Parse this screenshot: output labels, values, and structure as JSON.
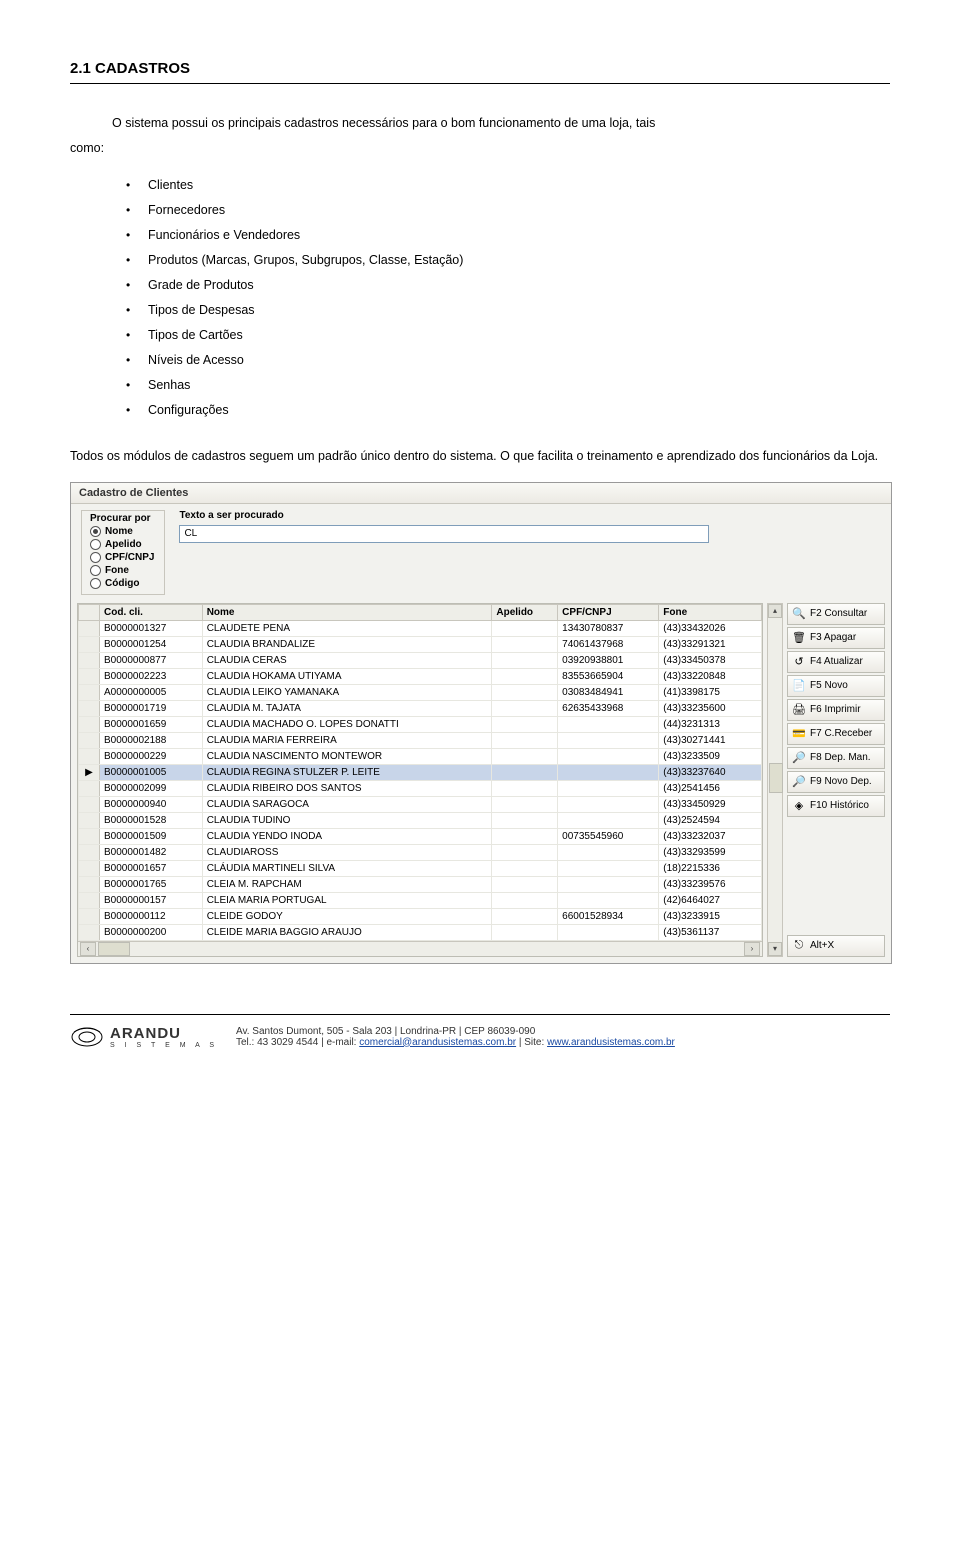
{
  "section_title": "2.1 CADASTROS",
  "intro_line": "O sistema possui os principais cadastros necessários para o bom funcionamento de uma loja, tais",
  "como_label": "como:",
  "bullets": [
    "Clientes",
    "Fornecedores",
    "Funcionários e Vendedores",
    "Produtos (Marcas, Grupos, Subgrupos, Classe, Estação)",
    "Grade de Produtos",
    "Tipos de Despesas",
    "Tipos de Cartões",
    "Níveis de Acesso",
    "Senhas",
    "Configurações"
  ],
  "closing_paragraph": "Todos os módulos de cadastros seguem um padrão único dentro do sistema. O que facilita o treinamento e aprendizado dos funcionários da Loja.",
  "dialog": {
    "title": "Cadastro de Clientes",
    "search_group_title": "Procurar por",
    "search_options": [
      "Nome",
      "Apelido",
      "CPF/CNPJ",
      "Fone",
      "Código"
    ],
    "search_selected_index": 0,
    "search_text_label": "Texto a ser procurado",
    "search_value": "CL",
    "columns": [
      "Cod. cli.",
      "Nome",
      "Apelido",
      "CPF/CNPJ",
      "Fone"
    ],
    "selected_row_index": 9,
    "rows": [
      {
        "cod": "B0000001327",
        "nome": "CLAUDETE PENA",
        "apelido": "",
        "cpf": "13430780837",
        "fone": "(43)33432026"
      },
      {
        "cod": "B0000001254",
        "nome": "CLAUDIA BRANDALIZE",
        "apelido": "",
        "cpf": "74061437968",
        "fone": "(43)33291321"
      },
      {
        "cod": "B0000000877",
        "nome": "CLAUDIA CERAS",
        "apelido": "",
        "cpf": "03920938801",
        "fone": "(43)33450378"
      },
      {
        "cod": "B0000002223",
        "nome": "CLAUDIA HOKAMA UTIYAMA",
        "apelido": "",
        "cpf": "83553665904",
        "fone": "(43)33220848"
      },
      {
        "cod": "A0000000005",
        "nome": "CLAUDIA LEIKO YAMANAKA",
        "apelido": "",
        "cpf": "03083484941",
        "fone": "(41)3398175"
      },
      {
        "cod": "B0000001719",
        "nome": "CLAUDIA M. TAJATA",
        "apelido": "",
        "cpf": "62635433968",
        "fone": "(43)33235600"
      },
      {
        "cod": "B0000001659",
        "nome": "CLAUDIA MACHADO O. LOPES DONATTI",
        "apelido": "",
        "cpf": "",
        "fone": "(44)3231313"
      },
      {
        "cod": "B0000002188",
        "nome": "CLAUDIA MARIA FERREIRA",
        "apelido": "",
        "cpf": "",
        "fone": "(43)30271441"
      },
      {
        "cod": "B0000000229",
        "nome": "CLAUDIA NASCIMENTO MONTEWOR",
        "apelido": "",
        "cpf": "",
        "fone": "(43)3233509"
      },
      {
        "cod": "B0000001005",
        "nome": "CLAUDIA REGINA STULZER P. LEITE",
        "apelido": "",
        "cpf": "",
        "fone": "(43)33237640"
      },
      {
        "cod": "B0000002099",
        "nome": "CLAUDIA RIBEIRO DOS SANTOS",
        "apelido": "",
        "cpf": "",
        "fone": "(43)2541456"
      },
      {
        "cod": "B0000000940",
        "nome": "CLAUDIA SARAGOCA",
        "apelido": "",
        "cpf": "",
        "fone": "(43)33450929"
      },
      {
        "cod": "B0000001528",
        "nome": "CLAUDIA TUDINO",
        "apelido": "",
        "cpf": "",
        "fone": "(43)2524594"
      },
      {
        "cod": "B0000001509",
        "nome": "CLAUDIA YENDO INODA",
        "apelido": "",
        "cpf": "00735545960",
        "fone": "(43)33232037"
      },
      {
        "cod": "B0000001482",
        "nome": "CLAUDIAROSS",
        "apelido": "",
        "cpf": "",
        "fone": "(43)33293599"
      },
      {
        "cod": "B0000001657",
        "nome": "CLÁUDIA MARTINELI SILVA",
        "apelido": "",
        "cpf": "",
        "fone": "(18)2215336"
      },
      {
        "cod": "B0000001765",
        "nome": "CLEIA M. RAPCHAM",
        "apelido": "",
        "cpf": "",
        "fone": "(43)33239576"
      },
      {
        "cod": "B0000000157",
        "nome": "CLEIA MARIA PORTUGAL",
        "apelido": "",
        "cpf": "",
        "fone": "(42)6464027"
      },
      {
        "cod": "B0000000112",
        "nome": "CLEIDE GODOY",
        "apelido": "",
        "cpf": "66001528934",
        "fone": "(43)3233915"
      },
      {
        "cod": "B0000000200",
        "nome": "CLEIDE MARIA BAGGIO ARAUJO",
        "apelido": "",
        "cpf": "",
        "fone": "(43)5361137"
      }
    ],
    "buttons": [
      {
        "label": "F2 Consultar",
        "icon": "🔍"
      },
      {
        "label": "F3 Apagar",
        "icon": "🗑"
      },
      {
        "label": "F4 Atualizar",
        "icon": "↺"
      },
      {
        "label": "F5 Novo",
        "icon": "📄"
      },
      {
        "label": "F6 Imprimir",
        "icon": "🖨"
      },
      {
        "label": "F7 C.Receber",
        "icon": "💳"
      },
      {
        "label": "F8 Dep. Man.",
        "icon": "🔎"
      },
      {
        "label": "F9 Novo Dep.",
        "icon": "🔎"
      },
      {
        "label": "F10 Histórico",
        "icon": "◈"
      }
    ],
    "alt_x_label": "Alt+X"
  },
  "footer": {
    "brand": "ARANDU",
    "brand_sub": "S I S T E M A S",
    "line1": "Av. Santos Dumont, 505 - Sala 203 | Londrina-PR | CEP 86039-090",
    "line2_prefix": "Tel.: 43 3029 4544 | e-mail: ",
    "email": "comercial@arandusistemas.com.br",
    "line2_mid": " | Site: ",
    "site": "www.arandusistemas.com.br"
  }
}
